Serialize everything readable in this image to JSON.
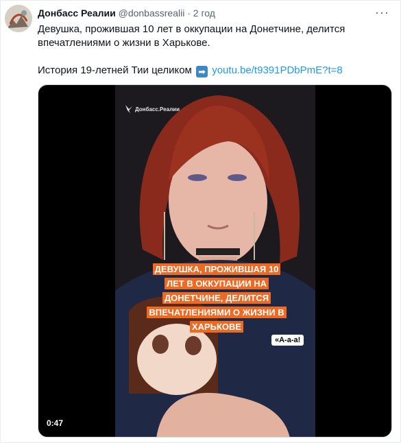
{
  "tweet": {
    "author_name": "Донбасс Реалии",
    "handle": "@donbassrealii",
    "separator": "·",
    "time": "2 год",
    "more_icon": "more-dots-icon",
    "text_line1": "Девушка, прожившая 10 лет в оккупации на Донетчине, делится впечатлениями о жизни в Харькове.",
    "text_line2_prefix": "История 19-летней Тии целиком",
    "arrow_icon": "right-arrow-icon",
    "link": "youtu.be/t9391PDbPmE?t=8"
  },
  "video": {
    "brand": "Донбасс.Реалии",
    "caption": "ДЕВУШКА, ПРОЖИВШАЯ 10 ЛЕТ В ОККУПАЦИИ НА ДОНЕТЧИНЕ, ДЕЛИТСЯ ВПЕЧАТЛЕНИЯМИ О ЖИЗНИ В ХАРЬКОВЕ",
    "quote": "«А-а-а!",
    "duration": "0:47"
  },
  "colors": {
    "link": "#1d9bf0",
    "caption_bg": "#ee6a22",
    "secondary_text": "#536471"
  }
}
